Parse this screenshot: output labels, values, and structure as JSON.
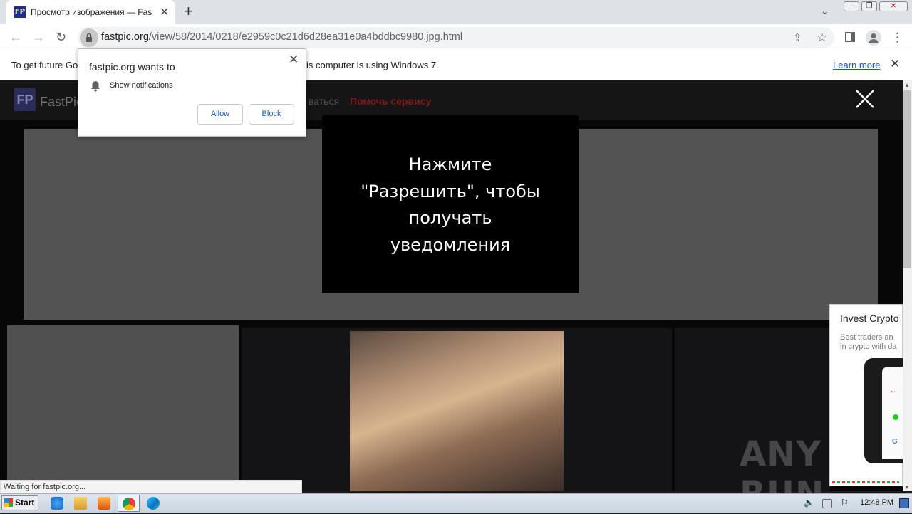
{
  "browser": {
    "tab_title": "Просмотр изображения — FastPic",
    "tab_favicon": "FP",
    "url_domain": "fastpic.org",
    "url_path": "/view/58/2014/0218/e2959c0c21d6d28ea31e0a4bddbc9980.jpg.html"
  },
  "infobar": {
    "text_left": "To get future Go",
    "text_right": "is computer is using Windows 7.",
    "learn_more": "Learn more"
  },
  "site": {
    "logo_mark": "FP",
    "logo_text": "FastPic",
    "nav_partial": "ваться",
    "nav_help": "Помочь сервису"
  },
  "overlay": {
    "lines": [
      "Нажмите",
      "\"Разрешить\", чтобы",
      "получать",
      "уведомления"
    ]
  },
  "popup": {
    "title": "fastpic.org wants to",
    "permission": "Show notifications",
    "allow": "Allow",
    "block": "Block"
  },
  "ad": {
    "title": "Invest Crypto",
    "sub_line1": "Best traders an",
    "sub_line2": "in crypto with da"
  },
  "watermark": "ANY RUN",
  "status_text": "Waiting for fastpic.org...",
  "taskbar": {
    "start": "Start",
    "clock": "12:48 PM"
  },
  "colors": {
    "accent_link": "#1a56c9",
    "help_link": "#7c1a1a"
  }
}
